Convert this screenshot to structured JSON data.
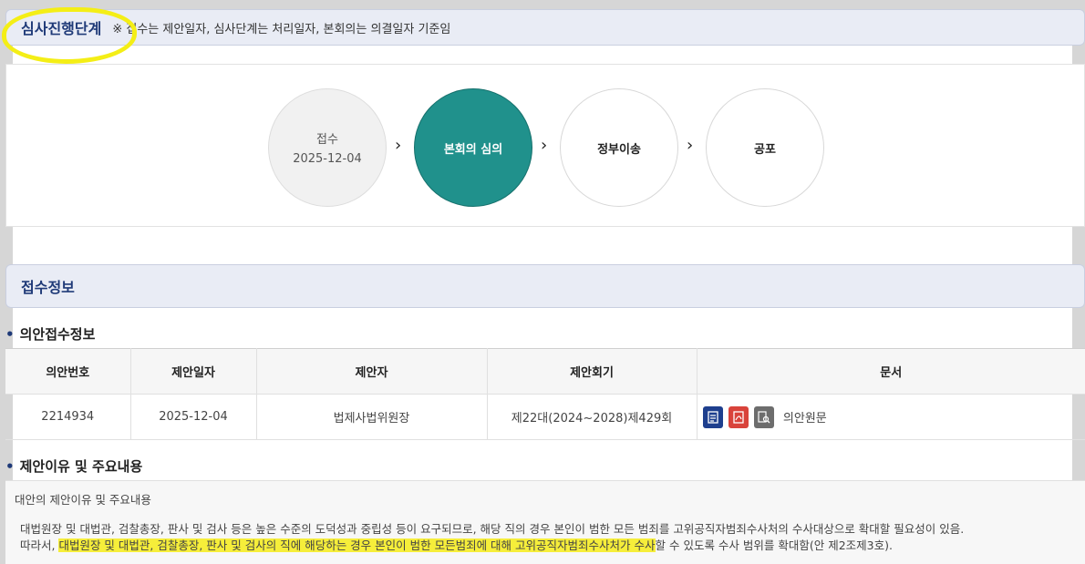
{
  "stage_section": {
    "title": "심사진행단계",
    "note": "※ 접수는 제안일자, 심사단계는 처리일자, 본회의는 의결일자 기준임",
    "steps": [
      {
        "label": "접수",
        "date": "2025-12-04",
        "state": "done"
      },
      {
        "label": "본회의 심의",
        "state": "active"
      },
      {
        "label": "정부이송",
        "state": "todo"
      },
      {
        "label": "공포",
        "state": "todo"
      }
    ],
    "arrow": "›"
  },
  "reception_section": {
    "title": "접수정보",
    "subtitle": "의안접수정보",
    "columns": [
      "의안번호",
      "제안일자",
      "제안자",
      "제안회기",
      "문서"
    ],
    "row": {
      "bill_no": "2214934",
      "date": "2025-12-04",
      "proposer": "법제사법위원장",
      "session": "제22대(2024~2028)제429회",
      "doc_label": "의안원문"
    },
    "doc_icons": [
      "hwp-file-icon",
      "pdf-file-icon",
      "document-view-icon"
    ]
  },
  "reason_section": {
    "title": "제안이유 및 주요내용",
    "heading": "대안의 제안이유 및 주요내용",
    "line1": "대법원장 및 대법관, 검찰총장, 판사 및 검사 등은 높은 수준의 도덕성과 중립성 등이 요구되므로, 해당 직의 경우 본인이 범한 모든 범죄를 고위공직자범죄수사처의 수사대상으로 확대할 필요성이 있음.",
    "line2_pre": "따라서, ",
    "line2_hl": "대법원장 및 대법관, 검찰총장, 판사 및 검사의 직에 해당하는 경우 본인이 범한 모든범죄에 대해 고위공직자범죄수사처가 수사",
    "line2_post": "할 수 있도록 수사 범위를 확대함(안 제2조제3호)."
  },
  "colors": {
    "accent": "#20918c",
    "header_text": "#1f3a78",
    "highlight": "#f6ee3a"
  }
}
